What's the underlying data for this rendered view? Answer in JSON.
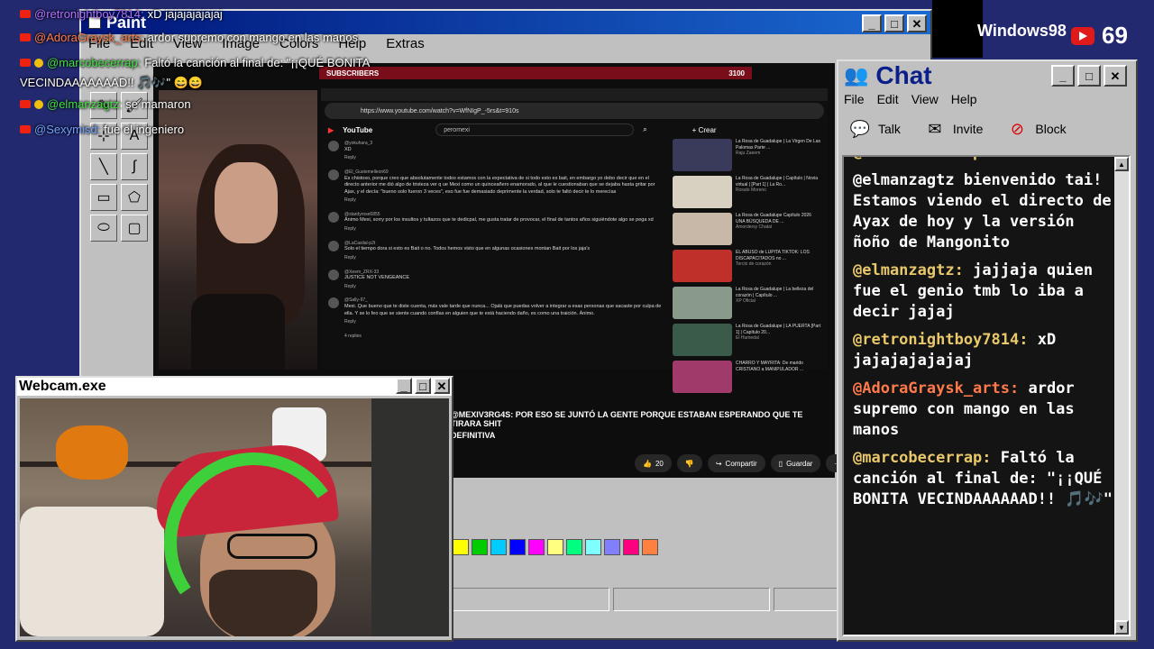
{
  "paint": {
    "title": "Paint",
    "menu": [
      "File",
      "Edit",
      "View",
      "Image",
      "Colors",
      "Help",
      "Extras"
    ],
    "palette": [
      "#ffff00",
      "#00cc00",
      "#00ccff",
      "#0000ff",
      "#ff00ff",
      "#ffff80",
      "#00ff80",
      "#80ffff",
      "#8080ff",
      "#ff0080",
      "#ff8040"
    ]
  },
  "stream": {
    "subscribers_label": "SUBSCRIBERS",
    "subscribers_count": "3100",
    "url": "https://www.youtube.com/watch?v=WfNIgP_-5rs&t=910s",
    "search": "peromexi",
    "create": "+ Crear",
    "signin": "Iniciar sesión",
    "overlay_line1": "@MEXIV3RG4S: POR ESO SE JUNTÓ LA GENTE PORQUE ESTABAN ESPERANDO QUE TE TIRARA SHIT",
    "overlay_line2": "DEFINITIVA",
    "likes": "20",
    "share": "Compartir",
    "save": "Guardar",
    "comments": [
      {
        "user": "@yokuhara_3",
        "text": "XD",
        "reply": "Reply"
      },
      {
        "user": "@El_Gustemelleon69",
        "text": "Es chistoso, porque creo que absolutamente todos estamos con la expectativa de si todo esto es bait, en embargo yo debo decir que en el directo anterior me dió algo de tristeza ver q ue Mexi como un quinceañero enamorado, al que le cuestionaban que se dejaba hasta gritar por Ajax, y el decía: \"bueno solo fueron 3 veces\", eso fue fue demasiado deprimente la verdad, solo te faltó decir te lo merecías",
        "reply": "Reply"
      },
      {
        "user": "@stardyrose6855",
        "text": "Ánimo Mexi, sorry por los insultos y tultazos que te dedicpal, me gusta tratar de provocar, el final de tantos años siguiéndote algo se pega xd",
        "reply": "Reply"
      },
      {
        "user": "@LaCasilal-p2t",
        "text": "Solo el tiempo dora si esto es Bait o no. Todos hemos visto que en algunas ocasiones montan Bait por los jaja's",
        "reply": "Reply"
      },
      {
        "user": "@Xeem_ZRX-33",
        "text": "JUSTICE NOT VENGEANCE",
        "reply": "Reply"
      },
      {
        "user": "@Sally-97_",
        "text": "Mexi. Que bueno que te diste cuenta, más vale tarde que nunca... Ojalá que puedas volver a integrar a esas personas que sacaste por culpa de ella. Y se lo feo que se siente cuando confías en alguien que te está haciendo daño, es como una traición. Ánimo.",
        "reply": "Reply"
      }
    ],
    "replies": "4 replies",
    "recommendations": [
      {
        "title": "La Rosa de Guadalupe | La Virgen De Las Palomas Parte ...",
        "meta": "Raju Zaeem"
      },
      {
        "title": "La Rosa de Guadalupe | Capítulo | Novia virtual | [Part 1] | La Ro...",
        "meta": "Rosalo Moreno"
      },
      {
        "title": "La Rosa de Guadalupe Capítulo 2026 UNA BÚSQUEDA DE ...",
        "meta": "Amordersy Chatal"
      },
      {
        "title": "EL ABUSO de LUPITA TIKTOK: LOS DISCAPACITADOS no ...",
        "meta": "Tercio de corazón"
      },
      {
        "title": "La Rosa de Guadalupe | La belleza del corazón | Capítulo ...",
        "meta": "XP Oficial"
      },
      {
        "title": "La Rosa de Guadalupe | LA PUERTA [Part 1] | Capítulo 20...",
        "meta": "El Humedal"
      },
      {
        "title": "CHARRO Y MAYRITA: De marido CRISTIANO a MANIPULADOR ...",
        "meta": ""
      }
    ]
  },
  "overlay_chat": [
    {
      "user": "@retronightboy7814:",
      "text": "xD jajajajajajaj",
      "color": "#b070ff"
    },
    {
      "user": "@AdoraGraysk_arts:",
      "text": "ardor supremo con mango en las manos",
      "color": "#ff7a4a"
    },
    {
      "user": "@marcobecerrap:",
      "text": "Faltó la canción al final de: \"¡¡QUÉ BONITA",
      "color": "#40e040"
    },
    {
      "user": "",
      "text": "VECINDAAAAAAAD!! 🎵🎶\" 😄😄",
      "color": "#ffffff"
    },
    {
      "user": "@elmanzagtz:",
      "text": "se mamaron",
      "color": "#40e040"
    },
    {
      "user": "@Sexymisd:",
      "text": "fue el ingeniero",
      "color": "#6fa0ff"
    }
  ],
  "webcam": {
    "title": "Webcam.exe"
  },
  "chat": {
    "title": "Chat",
    "menu": [
      "File",
      "Edit",
      "View",
      "Help"
    ],
    "tools": [
      "Talk",
      "Invite",
      "Block"
    ],
    "messages": [
      {
        "user": "@marcobecerrap:",
        "text": ""
      },
      {
        "user": "",
        "text": "@elmanzagtz bienvenido tai! Estamos viendo el directo de Ayax de hoy y la versión ñoño de Mangonito"
      },
      {
        "user": "@elmanzagtz:",
        "text": "jajjaja quien fue el genio tmb lo iba a decir jajaj"
      },
      {
        "user": "@retronightboy7814:",
        "text": "xD jajajajajajaj"
      },
      {
        "user": "@AdoraGraysk_arts:",
        "text": "ardor supremo con mango en las manos"
      },
      {
        "user": "@marcobecerrap:",
        "text": "Faltó la canción al final de: \"¡¡QUÉ BONITA VECINDAAAAAAD!! 🎵🎶\""
      }
    ],
    "user_colors": [
      "#e8c86a",
      "#ffffff",
      "#e8c86a",
      "#e8c86a",
      "#ff7a4a",
      "#e8c86a"
    ]
  },
  "badges": {
    "windows": "Windows98",
    "viewers": "69"
  }
}
